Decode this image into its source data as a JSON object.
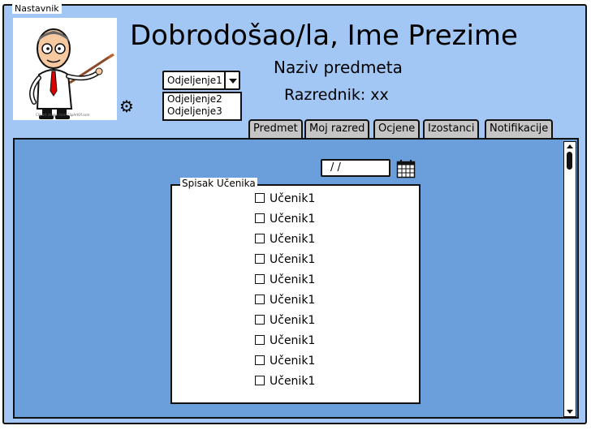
{
  "window": {
    "title": "Nastavnik"
  },
  "header": {
    "welcome": "Dobrodošao/la, Ime Prezime",
    "subject": "Naziv predmeta",
    "homeroom": "Razrednik: xx",
    "avatar_credit": "Clipart image from ClipArtOf.com"
  },
  "class_select": {
    "selected": "Odjeljenje1",
    "options": [
      "Odjeljenje2",
      "Odjeljenje3"
    ]
  },
  "icons": {
    "settings": "gear-icon",
    "calendar": "calendar-icon",
    "dropdown": "chevron-down-icon"
  },
  "tabs": [
    {
      "label": "Predmet"
    },
    {
      "label": "Moj razred"
    },
    {
      "label": "Ocjene"
    },
    {
      "label": "Izostanci"
    },
    {
      "label": "Notifikacije"
    }
  ],
  "date_field": {
    "value": "/ /"
  },
  "student_list": {
    "title": "Spisak Učenika",
    "students": [
      {
        "name": "Učenik1",
        "checked": false
      },
      {
        "name": "Učenik1",
        "checked": false
      },
      {
        "name": "Učenik1",
        "checked": false
      },
      {
        "name": "Učenik1",
        "checked": false
      },
      {
        "name": "Učenik1",
        "checked": false
      },
      {
        "name": "Učenik1",
        "checked": false
      },
      {
        "name": "Učenik1",
        "checked": false
      },
      {
        "name": "Učenik1",
        "checked": false
      },
      {
        "name": "Učenik1",
        "checked": false
      },
      {
        "name": "Učenik1",
        "checked": false
      }
    ]
  },
  "colors": {
    "background": "#a3c7f4",
    "panel": "#6b9fdb",
    "tab": "#c5c5c5"
  }
}
